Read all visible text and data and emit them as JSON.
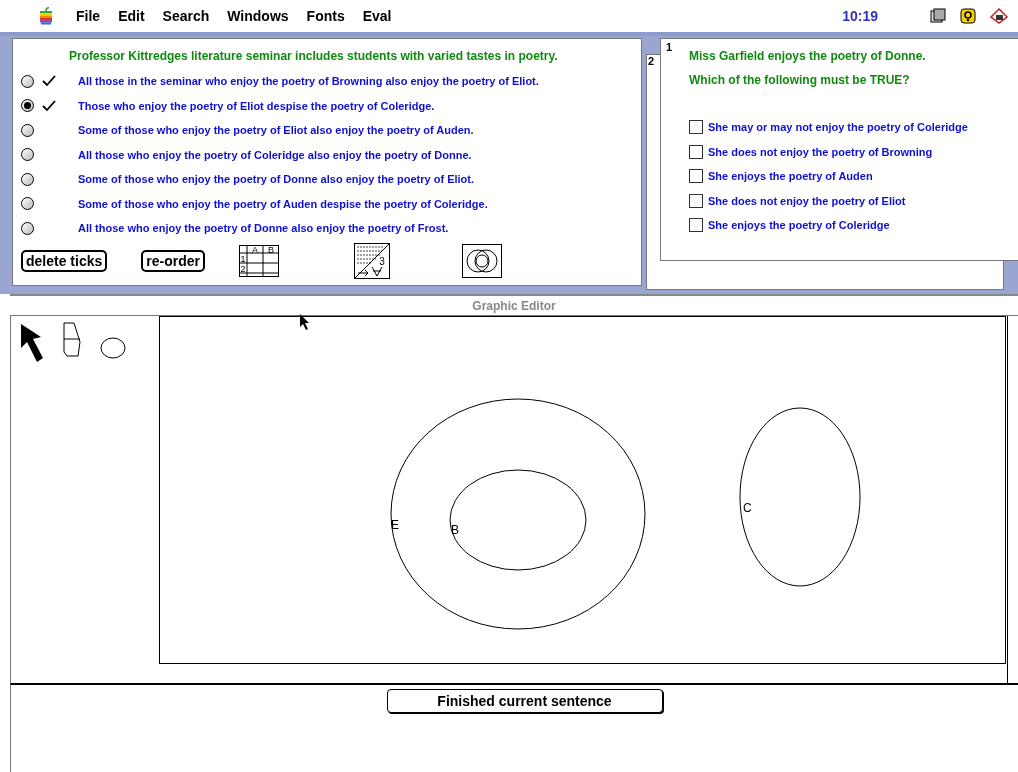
{
  "menu_bar": {
    "items": [
      "File",
      "Edit",
      "Search",
      "Windows",
      "Fonts",
      "Eval"
    ],
    "clock": "10:19"
  },
  "premises_panel": {
    "heading": "Professor Kittredges literature seminar includes students with varied tastes in poetry.",
    "sentences": [
      {
        "text": "All those in the seminar who enjoy the poetry of Browning also enjoy the poetry of Eliot.",
        "selected": false,
        "ticked": true
      },
      {
        "text": "Those who enjoy the poetry of Eliot despise the poetry of Coleridge.",
        "selected": true,
        "ticked": true
      },
      {
        "text": "Some of those who enjoy the poetry of Eliot also enjoy the poetry of Auden.",
        "selected": false,
        "ticked": false
      },
      {
        "text": "All those who enjoy the poetry of Coleridge also enjoy the poetry of Donne.",
        "selected": false,
        "ticked": false
      },
      {
        "text": "Some of those who enjoy the poetry of Donne also enjoy the poetry of Eliot.",
        "selected": false,
        "ticked": false
      },
      {
        "text": "Some of those who enjoy the poetry of Auden despise the poetry of Coleridge.",
        "selected": false,
        "ticked": false
      },
      {
        "text": "All those who enjoy the poetry of Donne also enjoy the poetry of Frost.",
        "selected": false,
        "ticked": false
      }
    ],
    "buttons": [
      "delete ticks",
      "re-order"
    ],
    "grid_icon": {
      "col_labels": [
        "A",
        "B"
      ],
      "row_labels": [
        "1",
        "2"
      ]
    },
    "proof_icon": {
      "digit": "3"
    }
  },
  "question_windows": [
    {
      "number": "2"
    },
    {
      "number": "1",
      "lines": [
        "Miss Garfield enjoys the poetry of Donne.",
        "Which of the following must be TRUE?"
      ],
      "options": [
        {
          "text": "She may or may not enjoy the poetry of Coleridge",
          "checked": false
        },
        {
          "text": "She does not enjoy the poetry of Browning",
          "checked": false
        },
        {
          "text": "She enjoys the poetry of Auden",
          "checked": false
        },
        {
          "text": "She does not enjoy the poetry of Eliot",
          "checked": false
        },
        {
          "text": "She enjoys the poetry of Coleridge",
          "checked": false
        }
      ]
    }
  ],
  "graphic_editor": {
    "title": "Graphic Editor",
    "shapes": [
      {
        "kind": "ellipse",
        "label": "E"
      },
      {
        "kind": "ellipse",
        "label": "B"
      },
      {
        "kind": "ellipse",
        "label": "C"
      }
    ]
  },
  "bottom_panel": {
    "button": "Finished current sentence"
  }
}
